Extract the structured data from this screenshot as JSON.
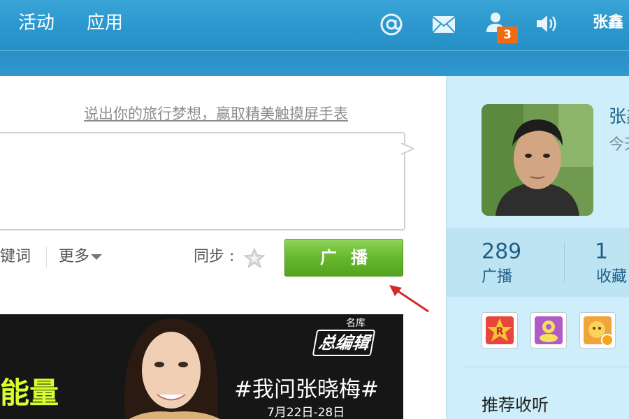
{
  "topnav": {
    "items": [
      {
        "label": "活动"
      },
      {
        "label": "应用"
      }
    ],
    "icons": [
      "at-icon",
      "mail-icon",
      "friends-icon",
      "sound-icon"
    ],
    "notification_count": "3",
    "user_name": "张鑫"
  },
  "composer": {
    "promo_link": "说出你的旅行梦想，赢取精美触摸屏手表",
    "keywords_label": "键词",
    "more_label": "更多",
    "sync_label": "同步 :",
    "broadcast_button": "广播"
  },
  "banner": {
    "left_text": "能量",
    "logo_top": "名库",
    "logo": "总编辑",
    "hashtag": "#我问张晓梅#",
    "date": "7月22日-28日"
  },
  "profile": {
    "name": "张鑫",
    "subtitle": "今天",
    "stats": [
      {
        "value": "289",
        "label": "广播"
      },
      {
        "value": "1",
        "label": "收藏"
      }
    ],
    "recommend_heading": "推荐收听"
  },
  "colors": {
    "nav_bar": "#2b97cd",
    "sidebar_bg": "#cdeefa",
    "button_green": "#67b82d",
    "badge_orange": "#f36b10",
    "link_gray": "#8c8c8c"
  }
}
